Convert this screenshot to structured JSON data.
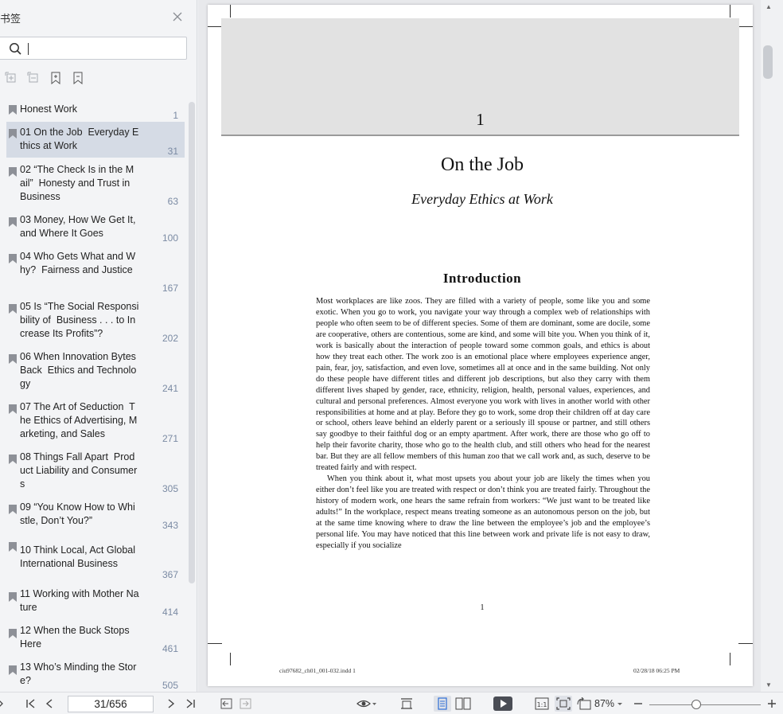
{
  "sidebar": {
    "title": "书签",
    "search": {
      "value": "",
      "placeholder": ""
    },
    "tools": [
      "expand-all-icon",
      "collapse-all-icon",
      "add-bookmark-icon",
      "bookmark-icon"
    ],
    "bookmarks": [
      {
        "label": "Honest Work",
        "page": "1"
      },
      {
        "label": "01 On the Job  Everyday Ethics at Work",
        "page": "31",
        "selected": true
      },
      {
        "label": "02 “The Check Is in the Mail”  Honesty and Trust in Business",
        "page": "63"
      },
      {
        "label": "03 Money, How We Get It,  and Where It Goes",
        "page": "100"
      },
      {
        "label": "04 Who Gets What and Why?  Fairness and Justice",
        "page": "167"
      },
      {
        "label": "05 Is “The Social Responsibility of  Business . . . to Increase Its Profits”?",
        "page": "202"
      },
      {
        "label": "06 When Innovation Bytes Back  Ethics and Technology",
        "page": "241"
      },
      {
        "label": "07 The Art of Seduction  The Ethics of Advertising, Marketing, and Sales",
        "page": "271"
      },
      {
        "label": "08 Things Fall Apart  Product Liability and Consumers",
        "page": "305"
      },
      {
        "label": "09 “You Know How to Whistle, Don’t You?”",
        "page": "343"
      },
      {
        "label": "10 Think Local, Act Global  International Business",
        "page": "367"
      },
      {
        "label": "11 Working with Mother Nature",
        "page": "414"
      },
      {
        "label": "12 When the Buck Stops Here",
        "page": "461"
      },
      {
        "label": "13 Who’s Minding the Store?",
        "page": "505"
      }
    ]
  },
  "document": {
    "chapter_number": "1",
    "chapter_title": "On the Job",
    "chapter_subtitle": "Everyday Ethics at Work",
    "section_heading": "Introduction",
    "paragraph1": "Most workplaces are like zoos. They are filled with a variety of people, some like you and some exotic. When you go to work, you navigate your way through a complex web of relationships with people who often seem to be of different species. Some of them are dominant, some are docile, some are cooperative, others are contentious, some are kind, and some will bite you. When you think of it, work is basically about the interaction of people toward some common goals, and ethics is about how they treat each other. The work zoo is an emotional place where employees experience anger, pain, fear, joy, satisfaction, and even love, sometimes all at once and in the same building. Not only do these people have different titles and different job descriptions, but also they carry with them different lives shaped by gender, race, ethnicity, religion, health, personal values, experiences, and cultural and personal preferences. Almost everyone you work with lives in another world with other responsibilities at home and at play. Before they go to work, some drop their children off at day care or school, others leave behind an elderly parent or a seriously ill spouse or partner, and still others say goodbye to their faithful dog or an empty apartment. After work, there are those who go off to help their favorite charity, those who go to the health club, and still others who head for the nearest bar. But they are all fellow members of this human zoo that we call work and, as such, deserve to be treated fairly and with respect.",
    "paragraph2": "When you think about it, what most upsets you about your job are likely the times when you either don’t feel like you are treated with respect or don’t think you are treated fairly. Throughout the history of modern work, one hears the same refrain from workers: “We just want to be treated like adults!” In the workplace, respect means treating someone as an autonomous person on the job, but at the same time knowing where to draw the line between the employee’s job and the employee’s personal life. You may have noticed that this line between work and private life is not easy to draw, especially if you socialize",
    "folio": "1",
    "slug_left": "ciu97682_ch01_001-032.indd   1",
    "slug_right": "02/28/18   06:25 PM"
  },
  "bottombar": {
    "page_indicator": "31/656",
    "zoom": "87%",
    "zoom_level_fraction": 0.38
  }
}
